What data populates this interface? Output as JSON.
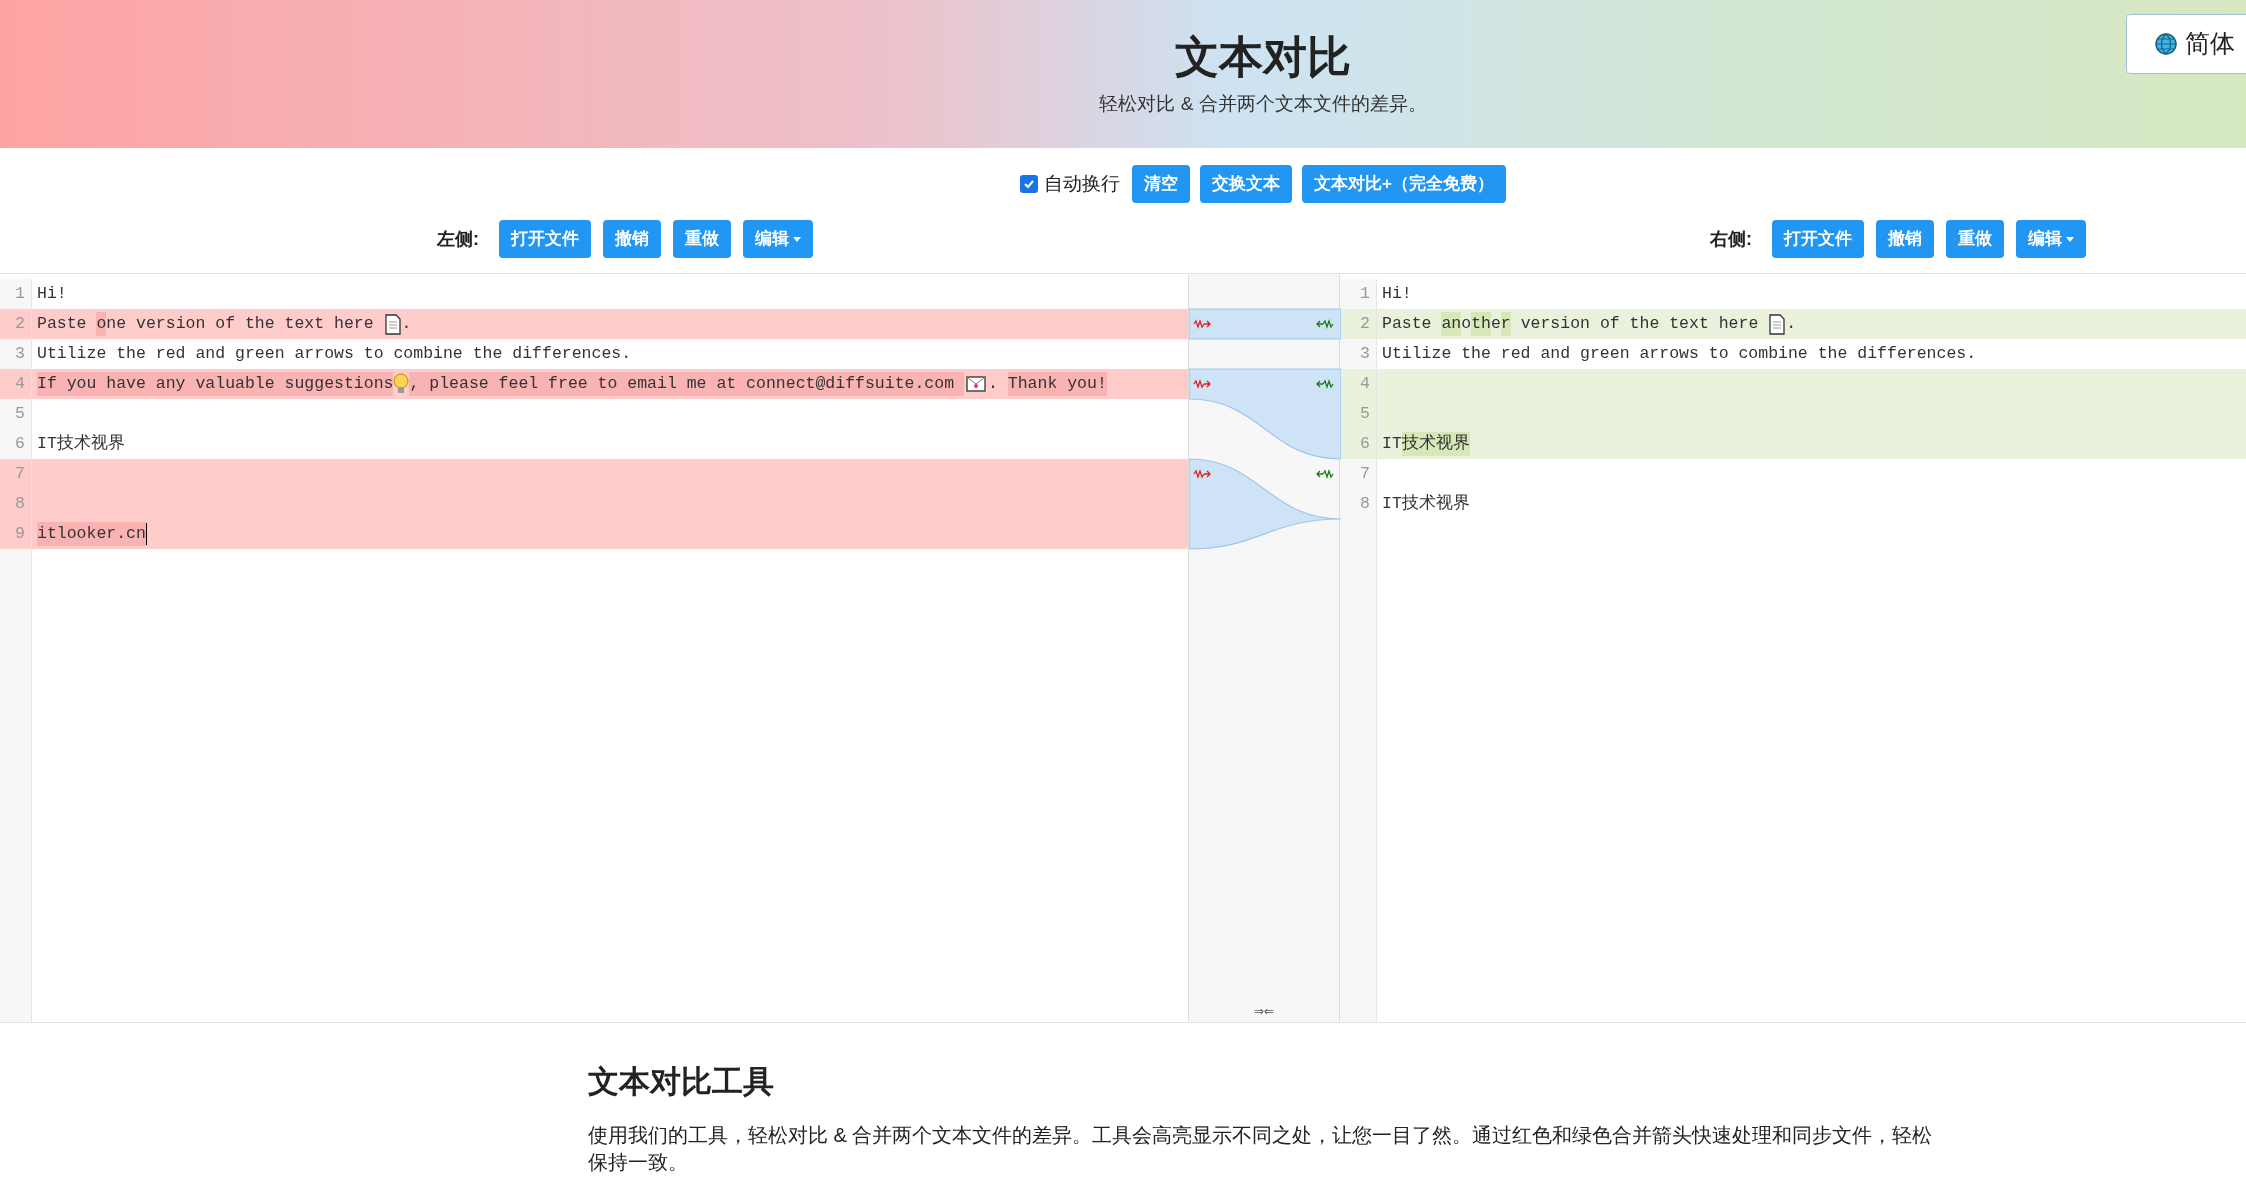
{
  "header": {
    "title": "文本对比",
    "subtitle": "轻松对比 & 合并两个文本文件的差异。",
    "language": "简体"
  },
  "toolbar": {
    "wrap": {
      "label": "自动换行",
      "checked": true
    },
    "buttons": [
      "清空",
      "交换文本",
      "文本对比+（完全免费）"
    ]
  },
  "panes": [
    {
      "label": "左侧:",
      "buttons": [
        "打开文件",
        "撤销",
        "重做"
      ],
      "menu": "编辑",
      "lines": [
        {
          "number": "1",
          "changed": false,
          "segments": [
            {
              "kind": "text",
              "text": "Hi!",
              "highlight": false
            }
          ]
        },
        {
          "number": "2",
          "changed": true,
          "segments": [
            {
              "kind": "text",
              "text": "Paste ",
              "highlight": false
            },
            {
              "kind": "text",
              "text": "o",
              "highlight": true
            },
            {
              "kind": "text",
              "text": "ne version of the text here ",
              "highlight": false
            },
            {
              "kind": "page"
            },
            {
              "kind": "text",
              "text": ".",
              "highlight": false
            }
          ]
        },
        {
          "number": "3",
          "changed": false,
          "segments": [
            {
              "kind": "text",
              "text": "Utilize the red and green arrows to combine the differences.",
              "highlight": false
            }
          ]
        },
        {
          "number": "4",
          "changed": true,
          "segments": [
            {
              "kind": "text",
              "text": "If you have any valuable suggestions",
              "highlight": true
            },
            {
              "kind": "bulb"
            },
            {
              "kind": "text",
              "text": ", please feel free to email me at connect@diffsuite.com ",
              "highlight": true
            },
            {
              "kind": "mail"
            },
            {
              "kind": "text",
              "text": ". ",
              "highlight": false
            },
            {
              "kind": "text",
              "text": "Thank you!",
              "highlight": true
            }
          ]
        },
        {
          "number": "5",
          "changed": false
        },
        {
          "number": "6",
          "changed": false,
          "segments": [
            {
              "kind": "text",
              "text": "IT技术视界",
              "highlight": false
            }
          ]
        },
        {
          "number": "7",
          "changed": true
        },
        {
          "number": "8",
          "changed": true
        },
        {
          "number": "9",
          "changed": true,
          "cursor": true,
          "segments": [
            {
              "kind": "text",
              "text": "itlooker.cn",
              "highlight": true
            }
          ]
        }
      ]
    },
    {
      "label": "右侧:",
      "buttons": [
        "打开文件",
        "撤销",
        "重做"
      ],
      "menu": "编辑",
      "lines": [
        {
          "number": "1",
          "changed": false,
          "segments": [
            {
              "kind": "text",
              "text": "Hi!",
              "highlight": false
            }
          ]
        },
        {
          "number": "2",
          "changed": true,
          "segments": [
            {
              "kind": "text",
              "text": "Paste ",
              "highlight": false
            },
            {
              "kind": "text",
              "text": "an",
              "highlight": true
            },
            {
              "kind": "text",
              "text": "o",
              "highlight": false
            },
            {
              "kind": "text",
              "text": "th",
              "highlight": true
            },
            {
              "kind": "text",
              "text": "e",
              "highlight": false
            },
            {
              "kind": "text",
              "text": "r",
              "highlight": true
            },
            {
              "kind": "text",
              "text": " version of the text here ",
              "highlight": false
            },
            {
              "kind": "page"
            },
            {
              "kind": "text",
              "text": ".",
              "highlight": false
            }
          ]
        },
        {
          "number": "3",
          "changed": false,
          "segments": [
            {
              "kind": "text",
              "text": "Utilize the red and green arrows to combine the differences.",
              "highlight": false
            }
          ]
        },
        {
          "number": "4",
          "changed": true
        },
        {
          "number": "5",
          "changed": true
        },
        {
          "number": "6",
          "changed": true,
          "segments": [
            {
              "kind": "text",
              "text": "IT",
              "highlight": false
            },
            {
              "kind": "text",
              "text": "技术视界",
              "highlight": true
            }
          ]
        },
        {
          "number": "7",
          "changed": false
        },
        {
          "number": "8",
          "changed": false,
          "segments": [
            {
              "kind": "text",
              "text": "IT技术视界",
              "highlight": false
            }
          ]
        }
      ]
    }
  ],
  "merge_gutter": {
    "footer": "⇒⇐"
  },
  "about": {
    "heading": "文本对比工具",
    "paragraph": "使用我们的工具，轻松对比 & 合并两个文本文件的差异。工具会高亮显示不同之处，让您一目了然。通过红色和绿色合并箭头快速处理和同步文件，轻松保持一致。"
  }
}
